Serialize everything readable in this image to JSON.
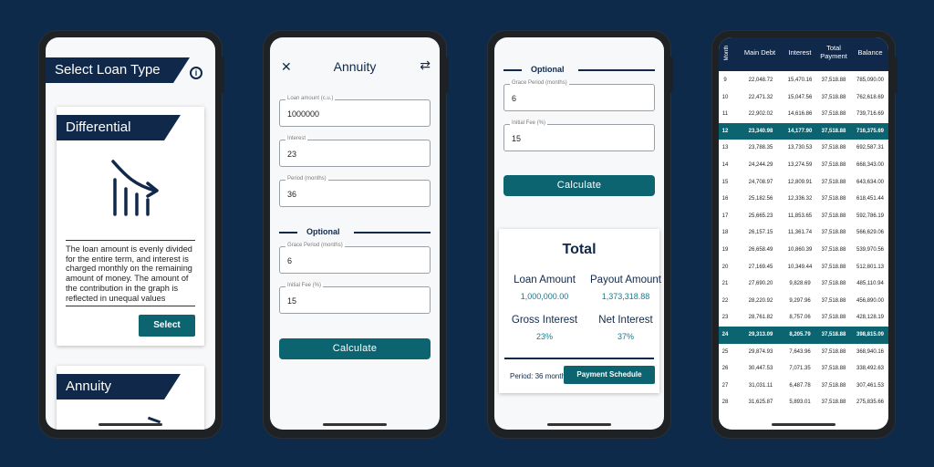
{
  "phone1": {
    "title": "Select Loan Type",
    "info_icon": "info-icon",
    "card1": {
      "title": "Differential",
      "icon": "chart-trend-down-icon",
      "description": "The loan amount is evenly divided for the entire term, and interest is charged monthly on the remaining amount of money. The amount of the contribution in the graph is reflected in unequal values",
      "button": "Select"
    },
    "card2": {
      "title": "Annuity"
    }
  },
  "phone2": {
    "title": "Annuity",
    "close_icon": "close-icon",
    "swap_icon": "swap-icon",
    "fields": [
      {
        "label": "Loan amount (c.u.)",
        "value": "1000000"
      },
      {
        "label": "Interest",
        "value": "23"
      },
      {
        "label": "Period (months)",
        "value": "36"
      }
    ],
    "optional_label": "Optional",
    "optional_fields": [
      {
        "label": "Grace Period (months)",
        "value": "6"
      },
      {
        "label": "Initial Fee (%)",
        "value": "15"
      }
    ],
    "calculate": "Calculate"
  },
  "phone3": {
    "optional_label": "Optional",
    "fields": [
      {
        "label": "Grace Period (months)",
        "value": "6"
      },
      {
        "label": "Initial Fee (%)",
        "value": "15"
      }
    ],
    "calculate": "Calculate",
    "total": {
      "title": "Total",
      "loan_amount_label": "Loan Amount",
      "loan_amount": "1,000,000.00",
      "payout_label": "Payout Amount",
      "payout": "1,373,318.88",
      "gross_label": "Gross Interest",
      "gross": "23%",
      "net_label": "Net Interest",
      "net": "37%",
      "period": "Period: 36 months",
      "schedule_button": "Payment Schedule"
    }
  },
  "phone4": {
    "headers": [
      "Month",
      "Main Debt",
      "Interest",
      "Total Payment",
      "Balance"
    ],
    "rows": [
      [
        "9",
        "22,048.72",
        "15,470.16",
        "37,518.88",
        "785,090.00"
      ],
      [
        "10",
        "22,471.32",
        "15,047.56",
        "37,518.88",
        "762,618.69"
      ],
      [
        "11",
        "22,902.02",
        "14,616.86",
        "37,518.88",
        "739,716.69"
      ],
      [
        "12",
        "23,340.98",
        "14,177.90",
        "37,518.88",
        "716,375.69"
      ],
      [
        "13",
        "23,788.35",
        "13,730.53",
        "37,518.88",
        "692,587.31"
      ],
      [
        "14",
        "24,244.29",
        "13,274.59",
        "37,518.88",
        "668,343.00"
      ],
      [
        "15",
        "24,708.97",
        "12,809.91",
        "37,518.88",
        "643,634.00"
      ],
      [
        "16",
        "25,182.56",
        "12,336.32",
        "37,518.88",
        "618,451.44"
      ],
      [
        "17",
        "25,665.23",
        "11,853.65",
        "37,518.88",
        "592,786.19"
      ],
      [
        "18",
        "26,157.15",
        "11,361.74",
        "37,518.88",
        "566,629.06"
      ],
      [
        "19",
        "26,658.49",
        "10,860.39",
        "37,518.88",
        "539,970.56"
      ],
      [
        "20",
        "27,169.45",
        "10,349.44",
        "37,518.88",
        "512,801.13"
      ],
      [
        "21",
        "27,690.20",
        "9,828.69",
        "37,518.88",
        "485,110.94"
      ],
      [
        "22",
        "28,220.92",
        "9,297.96",
        "37,518.88",
        "456,890.00"
      ],
      [
        "23",
        "28,761.82",
        "8,757.06",
        "37,518.88",
        "428,128.19"
      ],
      [
        "24",
        "29,313.09",
        "8,205.79",
        "37,518.88",
        "398,815.09"
      ],
      [
        "25",
        "29,874.93",
        "7,643.96",
        "37,518.88",
        "368,940.16"
      ],
      [
        "26",
        "30,447.53",
        "7,071.35",
        "37,518.88",
        "338,492.63"
      ],
      [
        "27",
        "31,031.11",
        "6,487.78",
        "37,518.88",
        "307,461.53"
      ],
      [
        "28",
        "31,625.87",
        "5,893.01",
        "37,518.88",
        "275,835.66"
      ]
    ],
    "highlighted_months": [
      "12",
      "24"
    ]
  },
  "colors": {
    "background": "#0e2a4a",
    "primary": "#10294a",
    "accent": "#0b6470"
  }
}
